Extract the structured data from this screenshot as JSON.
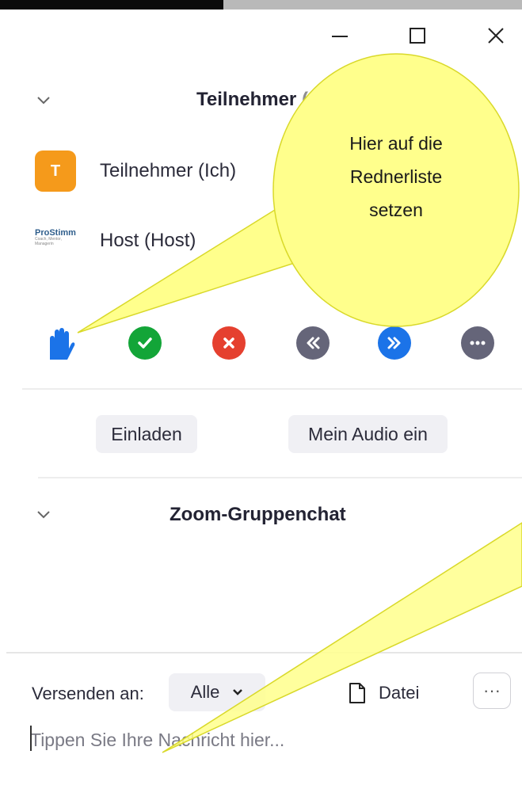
{
  "window": {
    "minimize_icon": "minimize-icon",
    "maximize_icon": "maximize-icon",
    "close_icon": "close-icon"
  },
  "participants": {
    "title": "Teilnehmer",
    "count": "(2)",
    "list": [
      {
        "avatar": "T",
        "name": "Teilnehmer (Ich)",
        "audio": "muted",
        "video": "off"
      },
      {
        "avatar": "ProStimm",
        "avatar_sub": "Coach, Mentor, Managerin",
        "name": "Host (Host)",
        "audio": "muted",
        "video": "on"
      }
    ]
  },
  "reactions": [
    {
      "name": "raise-hand",
      "icon": "hand-icon",
      "color": "#1b73e8"
    },
    {
      "name": "yes",
      "icon": "check-icon",
      "color": "#13a538"
    },
    {
      "name": "no",
      "icon": "x-icon",
      "color": "#e5402f"
    },
    {
      "name": "slower",
      "icon": "rewind-icon",
      "color": "#656579"
    },
    {
      "name": "faster",
      "icon": "fast-forward-icon",
      "color": "#1b73e8"
    },
    {
      "name": "more",
      "icon": "ellipsis-icon",
      "color": "#656579"
    }
  ],
  "buttons": {
    "invite": "Einladen",
    "audio": "Mein Audio ein"
  },
  "chat": {
    "title": "Zoom-Gruppenchat",
    "send_to_label": "Versenden an:",
    "recipient": "Alle",
    "file_label": "Datei",
    "more_label": "···",
    "placeholder": "Tippen Sie Ihre Nachricht hier..."
  },
  "callout": {
    "line1": "Hier auf die",
    "line2": "Rednerliste",
    "line3": "setzen",
    "fill": "#ffff8c",
    "stroke": "#d9d92a"
  },
  "colors": {
    "muted_orange": "#f29a1f",
    "avatar_orange": "#f59a1b"
  }
}
